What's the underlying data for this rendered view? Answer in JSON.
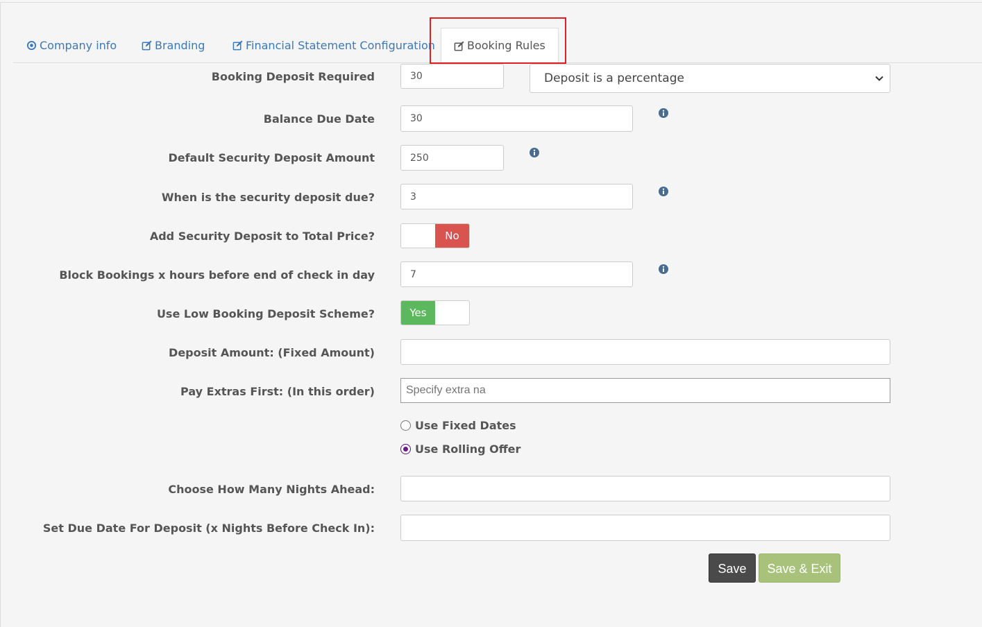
{
  "tabs": [
    {
      "label": "Company info",
      "icon": "dot-circle-icon"
    },
    {
      "label": "Branding",
      "icon": "edit-icon"
    },
    {
      "label": "Financial Statement Configuration",
      "icon": "edit-icon"
    },
    {
      "label": "Booking Rules",
      "icon": "edit-icon",
      "active": true
    }
  ],
  "form": {
    "booking_deposit": {
      "label": "Booking Deposit Required",
      "value": "30",
      "type_selected": "Deposit is a percentage"
    },
    "balance_due": {
      "label": "Balance Due Date",
      "value": "30"
    },
    "security_deposit_amount": {
      "label": "Default Security Deposit Amount",
      "value": "250"
    },
    "security_deposit_due": {
      "label": "When is the security deposit due?",
      "value": "3"
    },
    "add_security_deposit": {
      "label": "Add Security Deposit to Total Price?",
      "state": "No"
    },
    "block_bookings": {
      "label": "Block Bookings x hours before end of check in day",
      "value": "7"
    },
    "low_deposit_scheme": {
      "label": "Use Low Booking Deposit Scheme?",
      "state": "Yes"
    },
    "deposit_amount": {
      "label": "Deposit Amount: (Fixed Amount)",
      "value": ""
    },
    "pay_extras": {
      "label": "Pay Extras First: (In this order)",
      "placeholder": "Specify extra na"
    },
    "radio_options": [
      {
        "label": "Use Fixed Dates",
        "checked": false
      },
      {
        "label": "Use Rolling Offer",
        "checked": true
      }
    ],
    "nights_ahead": {
      "label": "Choose How Many Nights Ahead:",
      "value": ""
    },
    "due_date_deposit": {
      "label": "Set Due Date For Deposit (x Nights Before Check In):",
      "value": ""
    }
  },
  "buttons": {
    "save": "Save",
    "save_exit": "Save & Exit"
  },
  "colors": {
    "link": "#3c78b5",
    "no": "#d9534f",
    "yes": "#5cb85c",
    "save": "#4a4a4a",
    "save_exit": "#a9c27b",
    "highlight": "#e02020"
  }
}
